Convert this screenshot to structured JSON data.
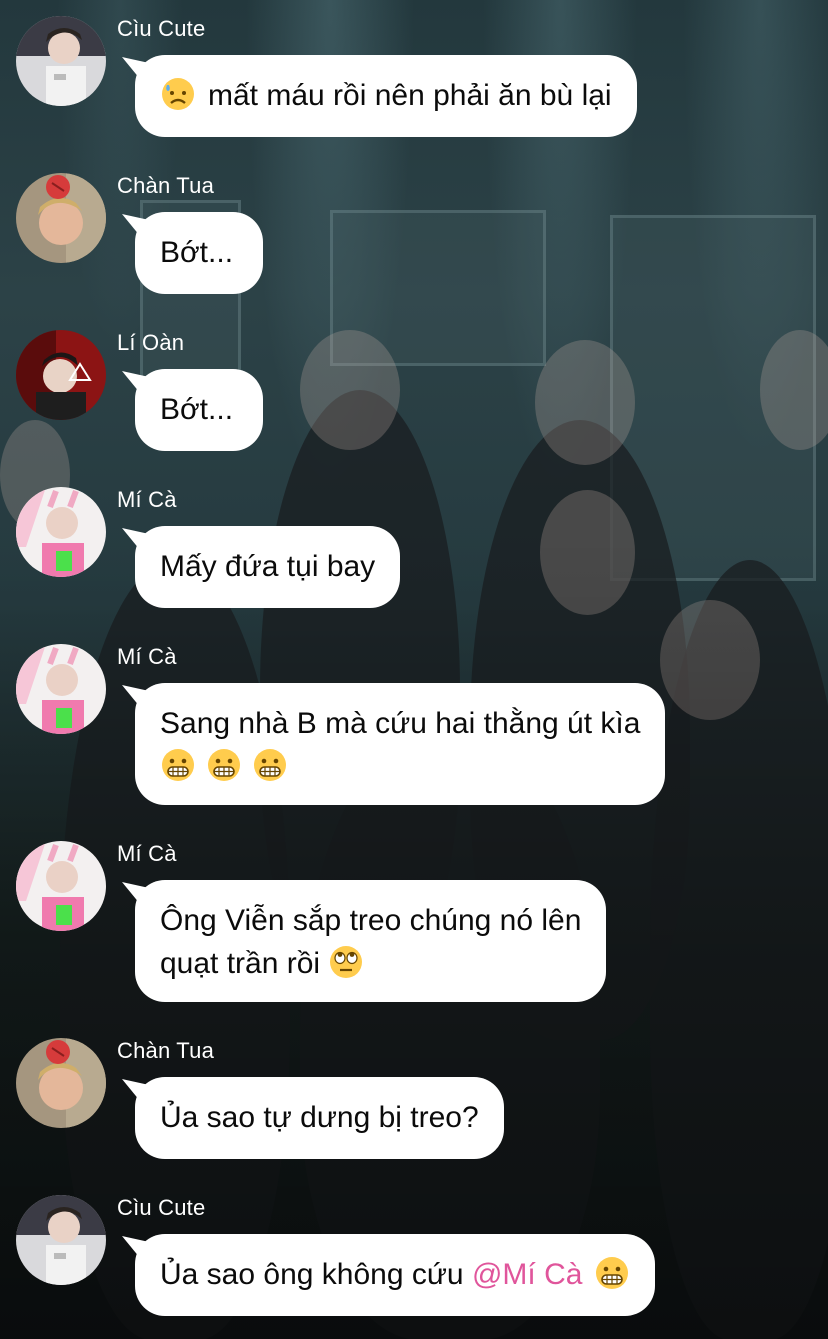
{
  "messages": [
    {
      "sender": "Cìu Cute",
      "avatar": "cau-cute-avatar",
      "text": [
        "mất máu rồi nên phải ăn bù lại"
      ],
      "emoji_lead": "sad-sweat-face"
    },
    {
      "sender": "Chàn Tua",
      "avatar": "chan-tua-avatar",
      "text": [
        "Bớt..."
      ]
    },
    {
      "sender": "Lí Oàn",
      "avatar": "li-oan-avatar",
      "text": [
        "Bớt..."
      ]
    },
    {
      "sender": "Mí Cà",
      "avatar": "mi-ca-avatar",
      "text": [
        "Mấy đứa tụi bay"
      ]
    },
    {
      "sender": "Mí Cà",
      "avatar": "mi-ca-avatar",
      "text": [
        "Sang nhà B mà cứu hai thằng út kìa",
        ""
      ],
      "emoji_tail": [
        "grimacing-face",
        "grimacing-face",
        "grimacing-face"
      ]
    },
    {
      "sender": "Mí Cà",
      "avatar": "mi-ca-avatar",
      "text": [
        "Ông Viễn sắp treo chúng nó lên",
        "quạt trần rồi"
      ],
      "emoji_tail": [
        "eye-roll-face"
      ]
    },
    {
      "sender": "Chàn Tua",
      "avatar": "chan-tua-avatar",
      "text": [
        "Ủa sao tự dưng bị treo?"
      ]
    },
    {
      "sender": "Cìu Cute",
      "avatar": "cau-cute-avatar",
      "text": [
        "Ủa sao ông không cứu "
      ],
      "mention": "@Mí Cà",
      "emoji_tail": [
        "grimacing-face"
      ]
    }
  ],
  "colors": {
    "bubble": "#ffffff",
    "mention": "#e0559b",
    "sender": "#ffffff"
  }
}
